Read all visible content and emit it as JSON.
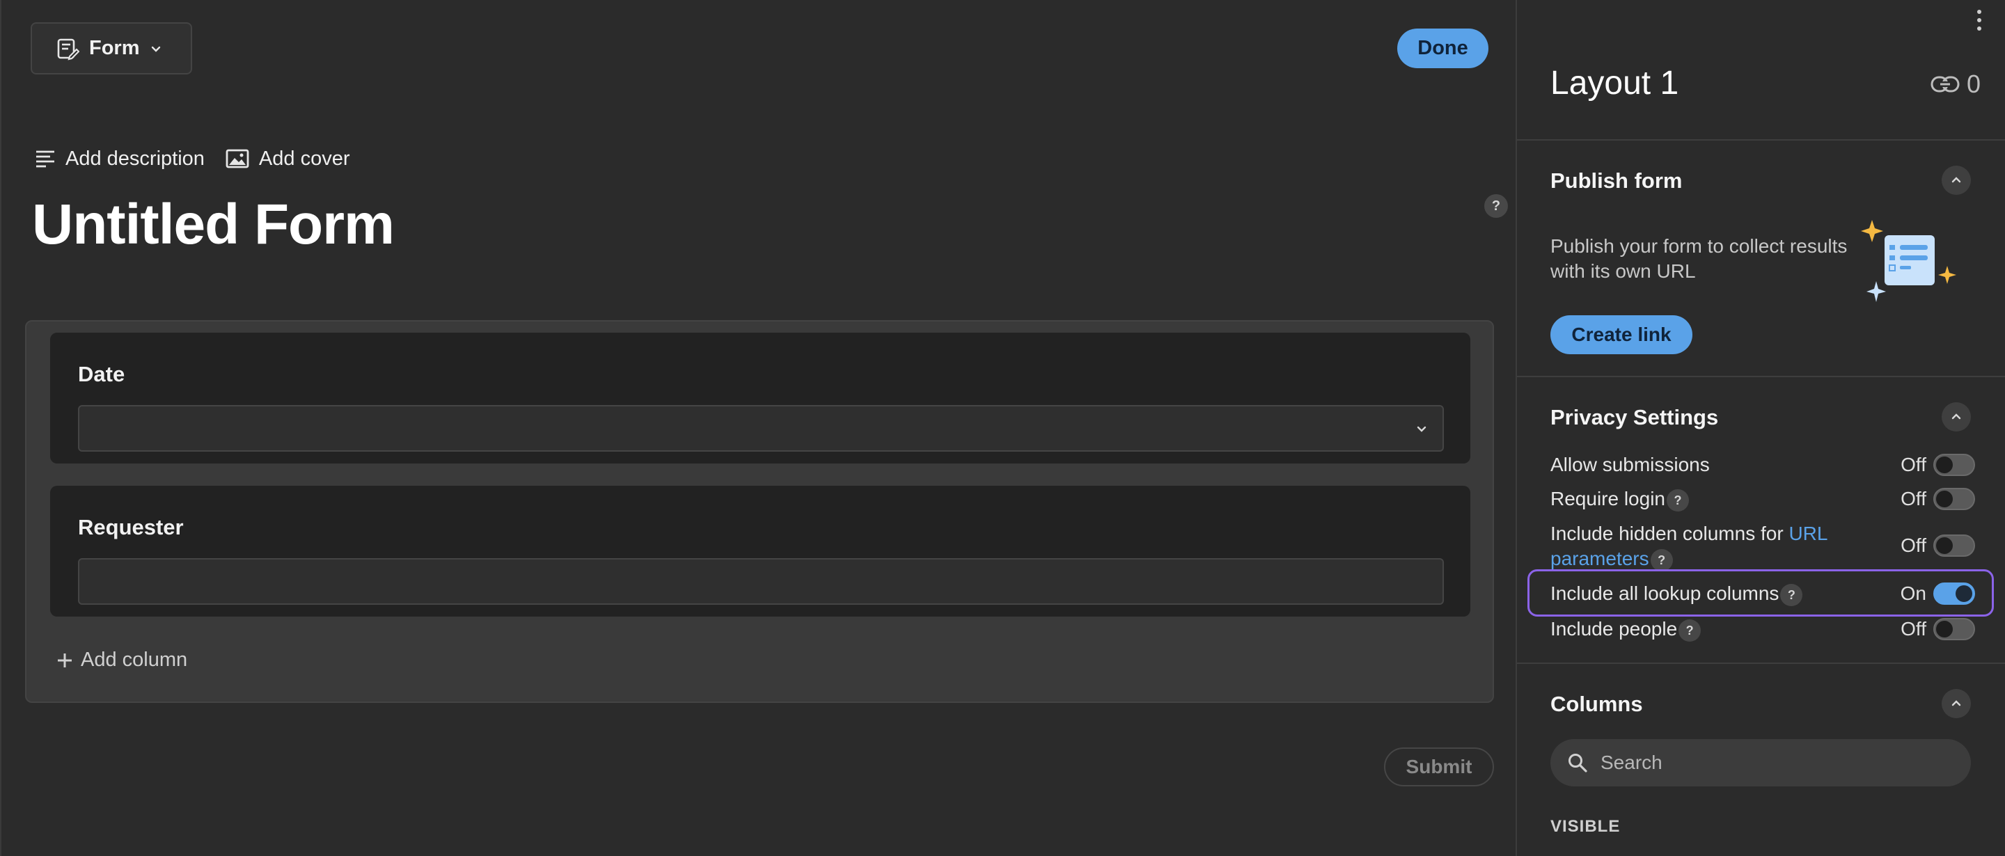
{
  "toolbar": {
    "form_label": "Form",
    "done_label": "Done"
  },
  "header": {
    "add_description": "Add description",
    "add_cover": "Add cover",
    "title": "Untitled Form",
    "help": "?"
  },
  "form": {
    "fields": [
      {
        "label": "Date",
        "type": "select",
        "value": ""
      },
      {
        "label": "Requester",
        "type": "text",
        "value": ""
      }
    ],
    "add_column": "Add column",
    "submit": "Submit"
  },
  "panel": {
    "title": "Layout 1",
    "link_count": "0",
    "publish": {
      "title": "Publish form",
      "text": "Publish your form to collect results with its own URL",
      "button": "Create link"
    },
    "privacy": {
      "title": "Privacy Settings",
      "rows": [
        {
          "label": "Allow submissions",
          "state": "Off",
          "help": false
        },
        {
          "label": "Require login",
          "state": "Off",
          "help": true
        },
        {
          "label_pre": "Include hidden columns for ",
          "label_link": "URL parameters",
          "state": "Off",
          "help": true
        },
        {
          "label": "Include all lookup columns",
          "state": "On",
          "help": true
        },
        {
          "label": "Include people",
          "state": "Off",
          "help": true
        }
      ]
    },
    "columns": {
      "title": "Columns",
      "search_placeholder": "Search",
      "visible_label": "VISIBLE"
    }
  },
  "colors": {
    "accent": "#5aa2e8",
    "highlight": "#8b63e8",
    "background": "#2b2b2b",
    "star": "#f5b942"
  }
}
